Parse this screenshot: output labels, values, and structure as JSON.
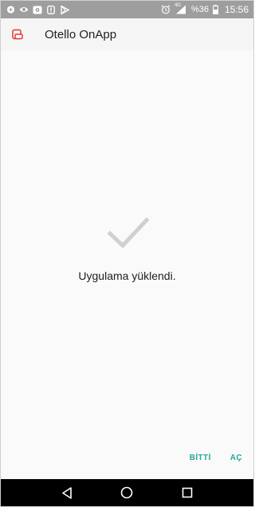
{
  "status_bar": {
    "battery_text": "%36",
    "network_label": "4G",
    "time": "15:56",
    "icons": [
      "chat-bubble-icon",
      "eye-icon",
      "screen-share-icon",
      "alert-icon",
      "play-store-icon",
      "alarm-icon",
      "signal-icon",
      "battery-icon"
    ]
  },
  "app_bar": {
    "title": "Otello OnApp",
    "icon": "app-logo-icon"
  },
  "content": {
    "status_icon": "checkmark-icon",
    "message": "Uygulama yüklendi."
  },
  "actions": {
    "done_label": "BİTTİ",
    "open_label": "AÇ"
  },
  "nav_bar": {
    "icons": [
      "back-icon",
      "home-icon",
      "recents-icon"
    ]
  },
  "colors": {
    "status_bar": "#9e9e9e",
    "accent": "#26a69a",
    "check": "#cfd0d2",
    "nav_bar": "#000000",
    "app_icon": "#e53935"
  }
}
